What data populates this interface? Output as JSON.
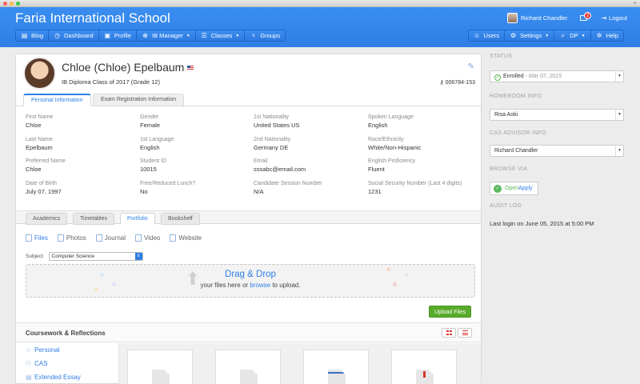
{
  "app": {
    "school_name": "Faria International School",
    "user_name": "Richard Chandler",
    "message_count": "2",
    "logout_label": "Logout"
  },
  "nav_left": [
    {
      "label": "Blog",
      "icon": "blog-icon",
      "dropdown": false
    },
    {
      "label": "Dashboard",
      "icon": "dashboard-icon",
      "dropdown": false
    },
    {
      "label": "Profile",
      "icon": "profile-icon",
      "dropdown": false
    },
    {
      "label": "IB Manager",
      "icon": "globe-icon",
      "dropdown": true
    },
    {
      "label": "Classes",
      "icon": "classes-icon",
      "dropdown": true
    },
    {
      "label": "Groups",
      "icon": "trophy-icon",
      "dropdown": false
    }
  ],
  "nav_right": [
    {
      "label": "Users",
      "icon": "user-icon",
      "dropdown": false
    },
    {
      "label": "Settings",
      "icon": "gear-icon",
      "dropdown": true
    },
    {
      "label": "DP",
      "icon": "search-icon",
      "dropdown": true
    },
    {
      "label": "Help",
      "icon": "lifebuoy-icon",
      "dropdown": false
    }
  ],
  "student": {
    "name": "Chloe (Chloe) Epelbaum",
    "subtitle": "IB Diploma Class of 2017 (Grade 12)",
    "id_number": "006784-153"
  },
  "info_tabs": [
    "Personal Information",
    "Exam Registration Information"
  ],
  "personal_fields": [
    {
      "label": "First Name",
      "value": "Chloe"
    },
    {
      "label": "Gender",
      "value": "Female"
    },
    {
      "label": "1st Nationality",
      "value": "United States US"
    },
    {
      "label": "Spoken Language",
      "value": "English"
    },
    {
      "label": "Last Name",
      "value": "Epelbaum"
    },
    {
      "label": "1st Language",
      "value": "English"
    },
    {
      "label": "2nd Nationality",
      "value": "Germany DE"
    },
    {
      "label": "Race/Ethnicity",
      "value": "White/Non-Hispanic"
    },
    {
      "label": "Preferred Name",
      "value": "Chloe"
    },
    {
      "label": "Student ID",
      "value": "10015"
    },
    {
      "label": "Email",
      "value": "sssabc@email.com"
    },
    {
      "label": "English Proficiency",
      "value": "Fluent"
    },
    {
      "label": "Date of Birth",
      "value": "July 07, 1997"
    },
    {
      "label": "Free/Reduced Lunch?",
      "value": "No"
    },
    {
      "label": "Candidate Session Number",
      "value": "N/A"
    },
    {
      "label": "Social Security Number (Last 4 digits)",
      "value": "1231"
    }
  ],
  "section_tabs": [
    "Academics",
    "Timetables",
    "Portfolio",
    "Bookshelf"
  ],
  "portfolio": {
    "subnav": [
      "Files",
      "Photos",
      "Journal",
      "Video",
      "Website"
    ],
    "subject_label": "Subject:",
    "subject_value": "Computer Science",
    "drop_title": "Drag & Drop",
    "drop_sub_before": "your files here or ",
    "drop_sub_link": "browse",
    "drop_sub_after": " to upload.",
    "upload_label": "Upload Files"
  },
  "coursework": {
    "title": "Coursework & Reflections",
    "items": [
      "Personal",
      "CAS",
      "Extended Essay"
    ]
  },
  "sidebar": {
    "status_heading": "STATUS",
    "status_value": "Enrolled",
    "status_date": " - Mar 07, 2015",
    "homeroom_heading": "HOMEROOM INFO",
    "homeroom_value": "Risa Aoki",
    "cas_heading": "CAS ADVISOR INFO",
    "cas_value": "Richard Chandler",
    "browse_heading": "BROWSE VIA",
    "openapply_open": "Open",
    "openapply_apply": "Apply",
    "audit_heading": "AUDIT LOG",
    "audit_text": "Last login on June 05, 2015 at 5:00 PM"
  },
  "colors": {
    "header_blue": "#2f7fe6",
    "link_blue": "#2f7fe6",
    "upload_green": "#58ab2b",
    "badge_red": "#e53935"
  }
}
